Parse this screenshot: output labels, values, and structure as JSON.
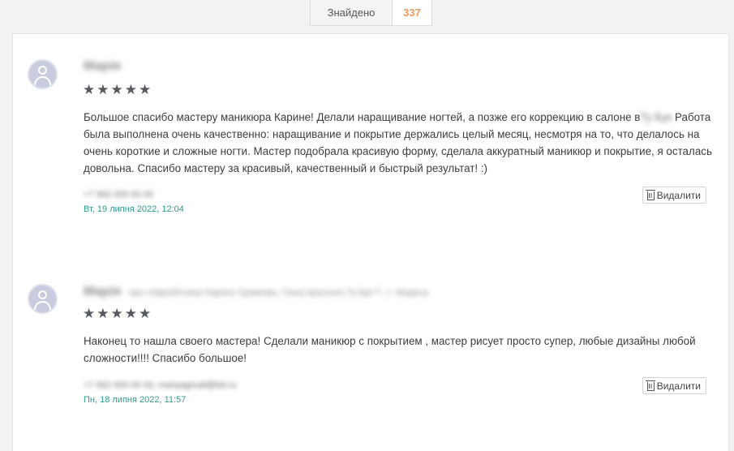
{
  "search_result": {
    "label": "Знайдено",
    "count": "337"
  },
  "reviews": [
    {
      "author": "Марія",
      "author_extra": "",
      "rating": 5,
      "text_before": "Большое спасибо мастеру маникюра Карине! Делали наращивание ногтей, а позже его коррекцию в салоне в",
      "text_hidden": "Ту Бук",
      "text_after": " Работа была выполнена очень качественно: наращивание и покрытие держались целый месяц, несмотря на то, что делалось на очень короткие и сложные ногти. Мастер подобрала красивую форму, сделала аккуратный маникюр и покрытие, я осталась довольна. Спасибо мастеру за красивый, качественный и быстрый результат! :)",
      "contact": "+7 962 000 00 00",
      "date": "Вт, 19 липня 2022, 12:04",
      "delete_label": "Видалити"
    },
    {
      "author": "Марія",
      "author_extra": "про співробітника Карина Гурамова, Гачка Краснога Ту Бук™, с. Модена",
      "rating": 5,
      "text_before": "Наконец то нашла своего мастера! Сделали маникюр с покрытием , мастер рисует просто супер, любые дизайны любой сложности!!!! Спасибо большое!",
      "text_hidden": "",
      "text_after": "",
      "contact": "+7 962 000 00 00, mariyagmail@list.ru",
      "date": "Пн, 18 липня 2022, 11:57",
      "delete_label": "Видалити"
    }
  ]
}
